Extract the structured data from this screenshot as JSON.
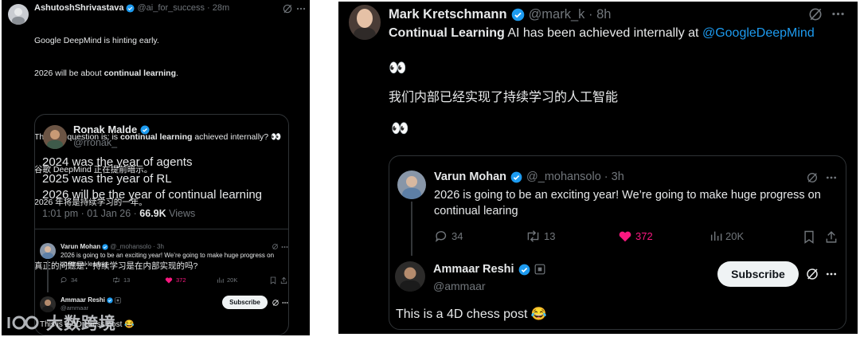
{
  "left": {
    "author": {
      "name": "AshutoshShrivastava",
      "handle": "@ai_for_success",
      "time": "28m"
    },
    "lines": [
      {
        "text": "Google DeepMind is hinting early.",
        "bold": ""
      },
      {
        "text": "2026 will be about ",
        "bold": "continual learning",
        "tail": "."
      },
      {
        "text": "The real question is: is ",
        "bold": "continual learning",
        "tail": " achieved internally? 👀"
      },
      {
        "text": "谷歌 DeepMind 正在提前暗示。"
      },
      {
        "text": "2026 年将是持续学习的一年。"
      },
      {
        "text": "真正的问题是：持续学习是在内部实现的吗?"
      }
    ],
    "quote": {
      "name": "Ronak Malde",
      "handle": "@rronak_",
      "body": [
        "2024 was the year of agents",
        "2025 was the year of RL",
        "2026 will be the year of continual learning"
      ],
      "meta_time": "1:01 pm · 01 Jan 26 · ",
      "views_count": "66.9K",
      "views_label": " Views"
    },
    "reply1": {
      "name": "Varun Mohan",
      "handle": "@_mohansolo · 3h",
      "body": "2026 is going to be an exciting year! We’re going to make huge progress on continual learing",
      "stats": {
        "replies": "34",
        "reposts": "13",
        "likes": "372",
        "views": "20K"
      }
    },
    "reply2": {
      "name": "Ammaar Reshi",
      "handle": "@ammaar",
      "body": "This is a 4D chess post 😂",
      "subscribe": "Subscribe"
    },
    "watermark": "大数跨境"
  },
  "right": {
    "author": {
      "name": "Mark Kretschmann",
      "handle": "@mark_k · 8h"
    },
    "line1": {
      "bold": "Continual Learning",
      "text": " AI has been achieved internally at ",
      "mention": "@GoogleDeepMind"
    },
    "eyes1": "👀",
    "chinese": "我们内部已经实现了持续学习的人工智能",
    "eyes2": "👀",
    "reply1": {
      "name": "Varun Mohan",
      "handle": "@_mohansolo · 3h",
      "body": "2026 is going to be an exciting year! We’re going to make huge progress on continual learing",
      "stats": {
        "replies": "34",
        "reposts": "13",
        "likes": "372",
        "views": "20K"
      }
    },
    "reply2": {
      "name": "Ammaar Reshi",
      "handle": "@ammaar",
      "body": "This is a 4D chess post 😂",
      "subscribe": "Subscribe"
    }
  },
  "colors": {
    "blue": "#1d9bf0",
    "like": "#f91880",
    "muted": "#71767b",
    "bg": "#000000"
  }
}
